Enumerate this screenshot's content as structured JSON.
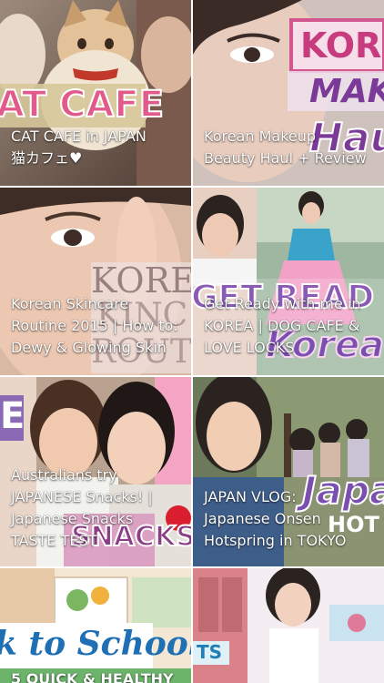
{
  "videos": [
    {
      "title": "CAT CAFE in JAPAN\n猫カフェ♥",
      "overlay": "AT CAFE"
    },
    {
      "title": "Korean Makeup\nBeauty Haul + Review",
      "overlay_top": "KORE",
      "overlay_mid": "MAK",
      "overlay_bot": "Hau"
    },
    {
      "title": "Korean Skincare\nRoutine 2015 | How to:\nDewy & Glowing Skin",
      "overlay_top": "KORE",
      "overlay_mid": "KINC",
      "overlay_bot": "ROUT"
    },
    {
      "title": "Get Ready with me in\nKOREA | DOG CAFE &\nLOVE LOCKS",
      "overlay_top": "GET READ",
      "overlay_bot": "Korea"
    },
    {
      "title": "Australians try\nJAPANESE Snacks! |\nJapanese Snacks\nTASTE TEST",
      "overlay_top": "E",
      "overlay_bot": "SNACKS"
    },
    {
      "title": "JAPAN VLOG:\nJapanese Onsen\nHotspring in TOKYO",
      "overlay_top": "Japa",
      "overlay_bot": "HOT SP"
    },
    {
      "title": "5 QUICK & HEALTHY",
      "overlay": "k to School"
    },
    {
      "title": "",
      "overlay": "TS"
    }
  ]
}
